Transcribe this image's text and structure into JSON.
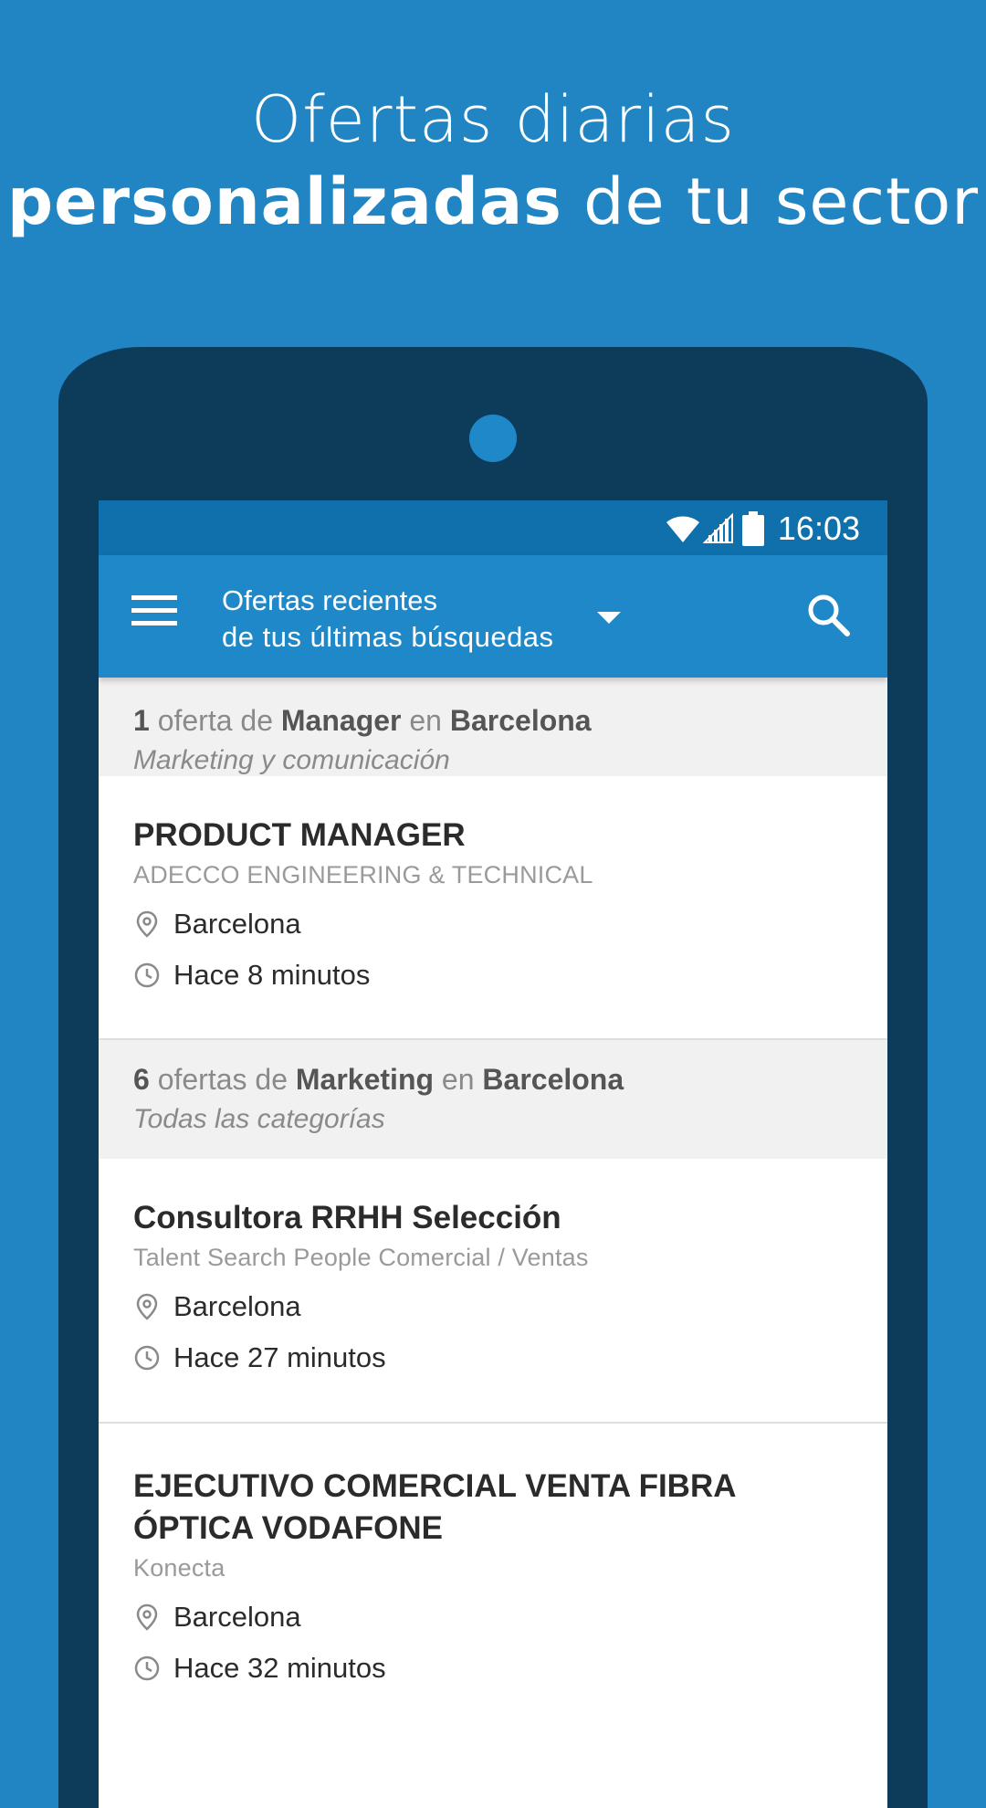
{
  "headline": {
    "line1": "Ofertas diarias",
    "line2_bold": "personalizadas",
    "line2_rest": " de tu sector"
  },
  "status_bar": {
    "time": "16:03",
    "icons": [
      "wifi-icon",
      "signal-icon",
      "battery-icon"
    ]
  },
  "app_bar": {
    "title": "Ofertas recientes",
    "subtitle": "de tus últimas búsquedas",
    "menu_icon": "hamburger-menu-icon",
    "dropdown_icon": "caret-down-icon",
    "search_icon": "search-icon"
  },
  "sections": [
    {
      "count": "1",
      "count_word": " oferta de ",
      "keyword": "Manager",
      "in_word": " en ",
      "location": "Barcelona",
      "category": "Marketing y comunicación",
      "jobs": [
        {
          "title": "PRODUCT MANAGER",
          "company": "ADECCO ENGINEERING & TECHNICAL",
          "location": "Barcelona",
          "posted": "Hace 8 minutos"
        }
      ]
    },
    {
      "count": "6",
      "count_word": " ofertas de ",
      "keyword": "Marketing",
      "in_word": " en ",
      "location": "Barcelona",
      "category": "Todas las categorías",
      "jobs": [
        {
          "title": "Consultora RRHH Selección",
          "company": "Talent Search People  Comercial / Ventas",
          "location": "Barcelona",
          "posted": "Hace 27 minutos"
        },
        {
          "title": "EJECUTIVO COMERCIAL VENTA FIBRA ÓPTICA  VODAFONE",
          "company": "Konecta",
          "location": "Barcelona",
          "posted": "Hace 32 minutos"
        }
      ]
    }
  ],
  "colors": {
    "background": "#2185c3",
    "phone_body": "#0d3b5a",
    "status_bar": "#0f70ab",
    "app_bar": "#1f88c9",
    "section_header_bg": "#f1f1f1"
  }
}
